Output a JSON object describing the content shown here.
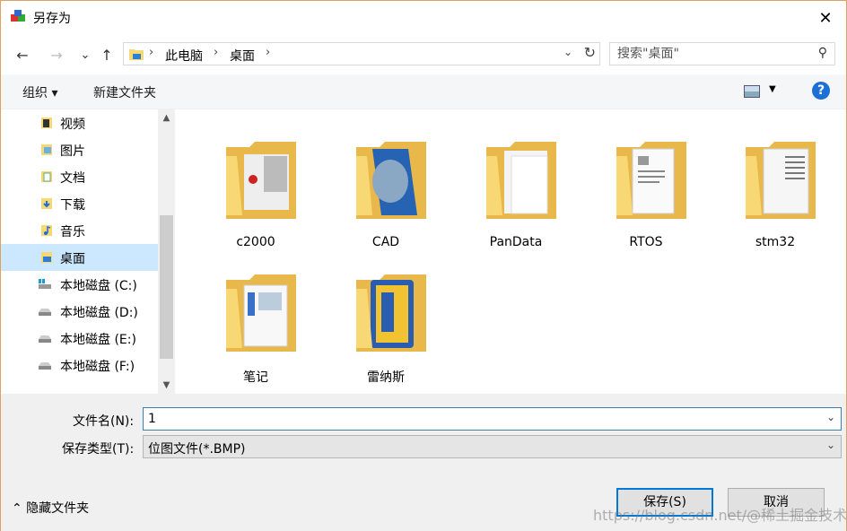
{
  "window": {
    "title": "另存为",
    "close_glyph": "✕"
  },
  "nav": {
    "back": "←",
    "forward": "→",
    "recent": "⌄",
    "up": "↑"
  },
  "address": {
    "crumbs": [
      "此电脑",
      "桌面"
    ],
    "separator": "›",
    "dropdown": "⌄",
    "refresh": "↻"
  },
  "search": {
    "placeholder": "搜索\"桌面\"",
    "icon_glyph": "⚲"
  },
  "toolbar": {
    "organize": "组织 ▾",
    "new_folder": "新建文件夹",
    "help": "?",
    "view_drop": "▼"
  },
  "sidebar": {
    "items": [
      {
        "label": "视频",
        "icon": "video-folder-icon"
      },
      {
        "label": "图片",
        "icon": "pictures-folder-icon"
      },
      {
        "label": "文档",
        "icon": "documents-folder-icon"
      },
      {
        "label": "下载",
        "icon": "downloads-folder-icon"
      },
      {
        "label": "音乐",
        "icon": "music-folder-icon"
      },
      {
        "label": "桌面",
        "icon": "desktop-folder-icon",
        "selected": true
      },
      {
        "label": "本地磁盘 (C:)",
        "icon": "windows-drive-icon"
      },
      {
        "label": "本地磁盘 (D:)",
        "icon": "drive-icon"
      },
      {
        "label": "本地磁盘 (E:)",
        "icon": "drive-icon"
      },
      {
        "label": "本地磁盘 (F:)",
        "icon": "drive-icon"
      }
    ],
    "scroll_up": "▲",
    "scroll_down": "▼"
  },
  "files": [
    {
      "name": "c2000",
      "icon": "folder-icon"
    },
    {
      "name": "CAD",
      "icon": "folder-icon"
    },
    {
      "name": "PanData",
      "icon": "folder-icon"
    },
    {
      "name": "RTOS",
      "icon": "folder-icon"
    },
    {
      "name": "stm32",
      "icon": "folder-icon"
    },
    {
      "name": "笔记",
      "icon": "folder-icon"
    },
    {
      "name": "雷纳斯",
      "icon": "folder-icon"
    }
  ],
  "form": {
    "filename_label": "文件名(N):",
    "filename_value": "1",
    "filetype_label": "保存类型(T):",
    "filetype_value": "位图文件(*.BMP)",
    "dropdown_arrow": "⌄"
  },
  "footer": {
    "hide_folders": "⌃  隐藏文件夹",
    "save": "保存(S)",
    "cancel": "取消"
  },
  "watermark": "https://blog.csdn.net/@稀土掘金技术社区",
  "colors": {
    "accent": "#0078d7",
    "selection": "#cce8ff",
    "folder": "#f8d775",
    "help": "#1c6fd4"
  }
}
